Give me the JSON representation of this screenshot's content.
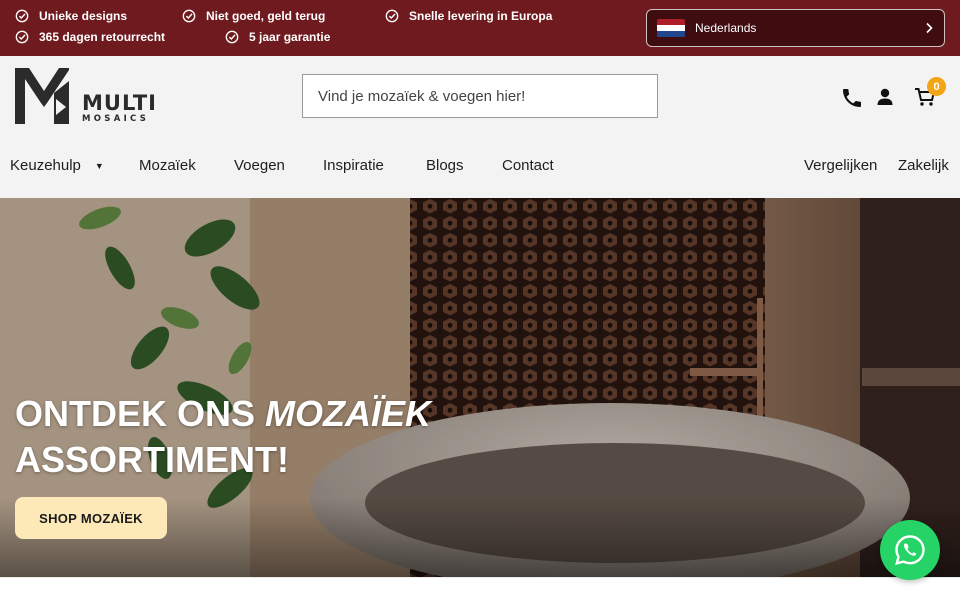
{
  "usps": [
    {
      "label": "Unieke designs",
      "icon": "check-circle-icon"
    },
    {
      "label": "365 dagen retourrecht",
      "icon": "check-circle-icon"
    },
    {
      "label": "Niet goed, geld terug",
      "icon": "check-circle-icon"
    },
    {
      "label": "5 jaar garantie",
      "icon": "check-circle-icon"
    },
    {
      "label": "Snelle levering in Europa",
      "icon": "check-circle-icon"
    }
  ],
  "language": {
    "label": "Nederlands",
    "flag": "nl-flag-icon"
  },
  "logo": {
    "line1": "MULTI",
    "line2": "MOSAICS"
  },
  "search": {
    "placeholder": "Vind je mozaïek & voegen hier!"
  },
  "cart": {
    "count": "0"
  },
  "nav": {
    "left": [
      "Keuzehulp",
      "Mozaïek",
      "Voegen",
      "Inspiratie",
      "Blogs",
      "Contact"
    ],
    "right": [
      "Vergelijken",
      "Zakelijk"
    ]
  },
  "hero": {
    "title_part1": "ONTDEK ONS",
    "title_italic": "MOZAÏEK",
    "title_line2": "ASSORTIMENT!",
    "button": "SHOP MOZAÏEK"
  },
  "colors": {
    "topbar": "#6f1a1e",
    "accent_badge": "#f2a516",
    "hero_button": "#fde8b8",
    "whatsapp": "#25d366"
  }
}
